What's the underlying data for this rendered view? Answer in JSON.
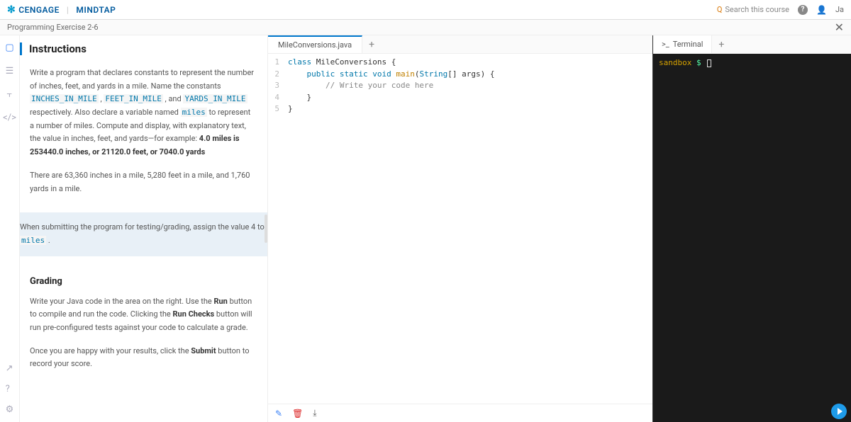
{
  "header": {
    "brand1": "CENGAGE",
    "brand2": "MINDTAP",
    "search_placeholder": "Search this course",
    "user_hint": "Ja"
  },
  "subheader": {
    "title": "Programming Exercise 2-6"
  },
  "instructions": {
    "heading": "Instructions",
    "p1_a": "Write a program that declares constants to represent the number of inches, feet, and yards in a mile. Name the constants ",
    "c1": "INCHES_IN_MILE",
    "p1_b": " , ",
    "c2": "FEET_IN_MILE",
    "p1_c": " , and ",
    "c3": "YARDS_IN_MILE",
    "p1_d": " respectively. Also declare a variable named ",
    "c4": "miles",
    "p1_e": " to represent a number of miles. Compute and display, with explanatory text, the value in inches, feet, and yards—for example: ",
    "p1_bold": "4.0 miles is 253440.0 inches, or 21120.0 feet, or 7040.0 yards",
    "p2": "There are 63,360 inches in a mile, 5,280 feet in a mile, and 1,760 yards in a mile.",
    "note_a": "When submitting the program for testing/grading, assign the value 4 to ",
    "note_code": "miles",
    "note_b": " .",
    "grading_h": "Grading",
    "g1_a": "Write your Java code in the area on the right. Use the ",
    "g1_b1": "Run",
    "g1_b": " button to compile and run the code. Clicking the ",
    "g1_b2": "Run Checks",
    "g1_c": " button will run pre-configured tests against your code to calculate a grade.",
    "g2_a": "Once you are happy with your results, click the ",
    "g2_b": "Submit",
    "g2_c": " button to record your score."
  },
  "editor": {
    "tab": "MileConversions.java",
    "lines": {
      "l1": "class MileConversions {",
      "l2a": "public static void ",
      "l2b": "main",
      "l2c": "(String[] args) {",
      "l3": "// Write your code here",
      "l4": "}",
      "l5": "}"
    }
  },
  "terminal": {
    "tab": "Terminal",
    "label": "sandbox",
    "dollar": "$"
  }
}
